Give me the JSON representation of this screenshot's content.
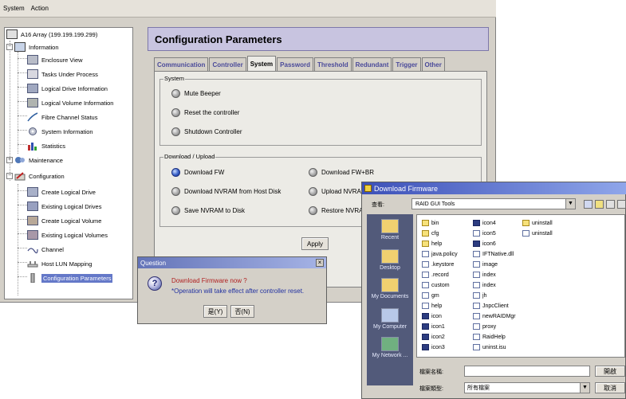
{
  "menubar": {
    "items": [
      "System",
      "Action"
    ]
  },
  "tree": {
    "root": "A16 Array (199.199.199.299)",
    "information": "Information",
    "info_children": [
      "Enclosure View",
      "Tasks Under Process",
      "Logical Drive Information",
      "Logical Volume Information",
      "Fibre Channel Status",
      "System Information",
      "Statistics"
    ],
    "maintenance": "Maintenance",
    "configuration": "Configuration",
    "config_children": [
      "Create Logical Drive",
      "Existing Logical Drives",
      "Create Logical Volume",
      "Existing Logical Volumes",
      "Channel",
      "Host LUN Mapping",
      "Configuration Parameters"
    ]
  },
  "panel": {
    "title": "Configuration Parameters",
    "tabs": [
      "Communication",
      "Controller",
      "System",
      "Password",
      "Threshold",
      "Redundant",
      "Trigger",
      "Other"
    ],
    "active_tab": "System",
    "system_group": {
      "title": "System",
      "options": [
        "Mute Beeper",
        "Reset the controller",
        "Shutdown Controller"
      ]
    },
    "download_group": {
      "title": "Download / Upload",
      "left_options": [
        "Download FW",
        "Download NVRAM from Host Disk",
        "Save NVRAM to Disk"
      ],
      "right_options": [
        "Download FW+BR",
        "Upload NVRAM",
        "Restore NVRAM"
      ],
      "selected": "Download FW"
    },
    "apply_label": "Apply"
  },
  "question_dialog": {
    "title": "Question",
    "close": "×",
    "icon_glyph": "?",
    "line1": "Download Firmware now ?",
    "line2": "*Operation will take effect after controller reset.",
    "yes_label": "是(Y)",
    "no_label": "否(N)"
  },
  "download_window": {
    "title": "Download Firmware",
    "look_in_label": "查看:",
    "look_in_value": "RAID GUI Tools",
    "combo_arrow": "▼",
    "places": [
      "Recent",
      "Desktop",
      "My Documents",
      "My Computer",
      "My Network ..."
    ],
    "files": [
      {
        "name": "bin",
        "type": "folder"
      },
      {
        "name": "cfg",
        "type": "folder"
      },
      {
        "name": "help",
        "type": "folder"
      },
      {
        "name": "java.policy",
        "type": "doc"
      },
      {
        "name": ".keystore",
        "type": "doc"
      },
      {
        "name": ".record",
        "type": "doc"
      },
      {
        "name": "custom",
        "type": "doc"
      },
      {
        "name": "gm",
        "type": "doc"
      },
      {
        "name": "help",
        "type": "doc"
      },
      {
        "name": "icon",
        "type": "exe"
      },
      {
        "name": "icon1",
        "type": "exe"
      },
      {
        "name": "icon2",
        "type": "exe"
      },
      {
        "name": "icon3",
        "type": "exe"
      },
      {
        "name": "icon4",
        "type": "exe"
      },
      {
        "name": "icon5",
        "type": "doc"
      },
      {
        "name": "icon6",
        "type": "exe"
      },
      {
        "name": "IFTNative.dll",
        "type": "doc"
      },
      {
        "name": "image",
        "type": "doc"
      },
      {
        "name": "index",
        "type": "doc"
      },
      {
        "name": "index",
        "type": "doc"
      },
      {
        "name": "jh",
        "type": "doc"
      },
      {
        "name": "JnpcClient",
        "type": "doc"
      },
      {
        "name": "newRAIDMgr",
        "type": "doc"
      },
      {
        "name": "proxy",
        "type": "doc"
      },
      {
        "name": "RaidHelp",
        "type": "doc"
      },
      {
        "name": "uninst.isu",
        "type": "doc"
      },
      {
        "name": "uninstall",
        "type": "folder"
      },
      {
        "name": "uninstall",
        "type": "doc"
      }
    ],
    "filename_label": "檔案名稱:",
    "filename_value": "",
    "filetype_label": "檔案類型:",
    "filetype_value": "所有檔案",
    "open_label": "開啟",
    "cancel_label": "取消"
  }
}
